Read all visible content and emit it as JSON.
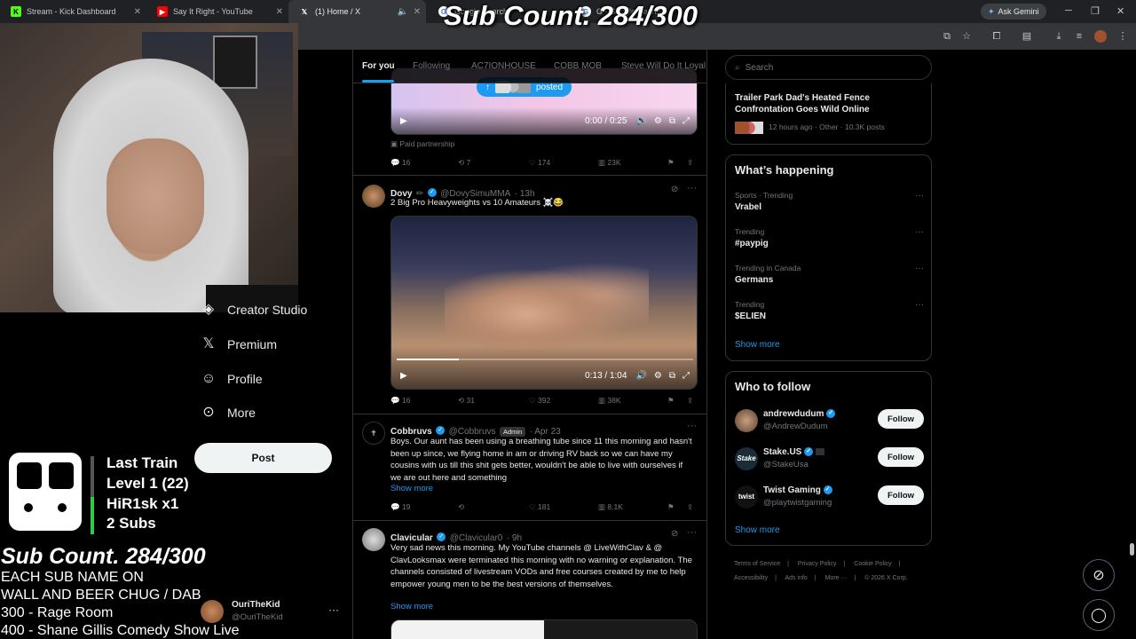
{
  "browser": {
    "tabs": [
      {
        "label": "Stream - Kick Dashboard",
        "favicon": "kick-icon",
        "color": "#53fc18"
      },
      {
        "label": "Say It Right - YouTube",
        "favicon": "youtube-icon",
        "color": "#ff0000"
      },
      {
        "label": "(1) Home / X",
        "favicon": "x-icon",
        "color": "#ffffff"
      },
      {
        "label": "Google Search",
        "favicon": "google-icon",
        "color": "#4285f4"
      },
      {
        "label": "G - Google Search",
        "favicon": "google-icon",
        "color": "#4285f4"
      }
    ],
    "gemini_label": "Ask Gemini"
  },
  "overlay": {
    "sub_count_top": "Sub Count. 284/300",
    "train_title": "Last Train",
    "train_level": "Level 1  (22)",
    "train_user": "HiR1sk x1",
    "train_subs": "2 Subs",
    "sub_count": "Sub Count. 284/300",
    "goal_line1": "EACH SUB NAME ON",
    "goal_line2": "WALL AND BEER CHUG / DAB",
    "goal_line3": "300 - Rage Room",
    "goal_line4": "400 - Shane Gillis Comedy Show Live"
  },
  "nav": {
    "items": [
      {
        "label": "Creator Studio",
        "icon": "creator-studio-icon"
      },
      {
        "label": "Premium",
        "icon": "x-logo-icon"
      },
      {
        "label": "Profile",
        "icon": "person-icon"
      },
      {
        "label": "More",
        "icon": "more-circle-icon"
      }
    ],
    "post_label": "Post",
    "account_name": "OuriTheKid",
    "account_handle": "@OuriTheKid"
  },
  "timeline": {
    "tabs": [
      "For you",
      "Following",
      "AC7IONHOUSE",
      "COBB MOB",
      "Steve Will Do It Loyal"
    ],
    "posted_pill": "posted",
    "posts": [
      {
        "video_time": "0:00 / 0:25",
        "paid_label": "Paid partnership",
        "replies": "16",
        "reposts": "7",
        "likes": "174",
        "views": "23K"
      },
      {
        "name": "Dovy",
        "handle": "@DovySimuMMA",
        "time": "· 13h",
        "text": "2 Big Pro Heavyweights vs 10 Amateurs ☠️😂",
        "video_time": "0:13 / 1:04",
        "replies": "16",
        "reposts": "31",
        "likes": "392",
        "views": "38K"
      },
      {
        "name": "Cobbruvs",
        "handle": "@Cobbruvs",
        "badge": "Admin",
        "time": "· Apr 23",
        "text": "Boys. Our aunt has been using a breathing tube since 11 this morning and hasn't been up since,  we flying home in am  or driving RV back so we can have my cousins with us till this shit  gets better, wouldn't be able to live with ourselves if we are out here and something",
        "show_more": "Show more",
        "replies": "19",
        "reposts": "",
        "likes": "181",
        "views": "8.1K"
      },
      {
        "name": "Clavicular",
        "handle": "@Clavicular0",
        "time": "· 9h",
        "text": "Very sad news this morning. My YouTube channels @ LiveWithClav & @ ClavLooksmax were terminated this morning with no warning or explanation. The channels consisted of livestream VODs and free courses created by me to help empower young men to be the best versions of themselves.",
        "show_more": "Show more"
      }
    ]
  },
  "sidebar": {
    "search_placeholder": "Search",
    "top_story": {
      "title": "Trailer Park Dad's Heated Fence Confrontation Goes Wild Online",
      "meta": "12 hours ago · Other · 10.3K posts"
    },
    "happening_title": "What’s happening",
    "trends": [
      {
        "category": "Sports · Trending",
        "name": "Vrabel"
      },
      {
        "category": "Trending",
        "name": "#paypig"
      },
      {
        "category": "Trending in Canada",
        "name": "Germans"
      },
      {
        "category": "Trending",
        "name": "$ELIEN"
      }
    ],
    "show_more": "Show more",
    "who_to_follow_title": "Who to follow",
    "follow": [
      {
        "name": "andrewdudum",
        "handle": "@AndrewDudum",
        "button": "Follow"
      },
      {
        "name": "Stake.US",
        "handle": "@StakeUsa",
        "button": "Follow"
      },
      {
        "name": "Twist Gaming",
        "handle": "@playtwistgaming",
        "button": "Follow"
      }
    ],
    "show_more_follow": "Show more",
    "footer": [
      "Terms of Service",
      "Privacy Policy",
      "Cookie Policy",
      "Accessibility",
      "Ads info",
      "More ···",
      "© 2026 X Corp."
    ]
  },
  "colors": {
    "accent": "#1d9bf0",
    "background": "#000000",
    "border": "#2f3336"
  }
}
